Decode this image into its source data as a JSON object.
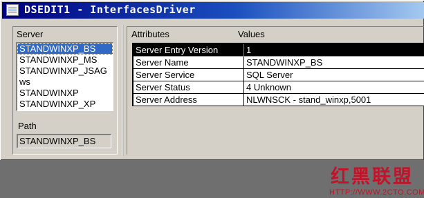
{
  "window": {
    "title": "DSEDIT1 - InterfacesDriver",
    "icon": "dsedit-app-icon"
  },
  "server_panel": {
    "label": "Server",
    "items": [
      "STANDWINXP_BS",
      "STANDWINXP_MS",
      "STANDWINXP_JSAG",
      "ws",
      "STANDWINXP",
      "STANDWINXP_XP"
    ],
    "selected_index": 0
  },
  "path_panel": {
    "label": "Path",
    "value": "STANDWINXP_BS"
  },
  "attributes_grid": {
    "col_attributes": "Attributes",
    "col_values": "Values",
    "rows": [
      {
        "attribute": "Server Entry Version",
        "value": "1"
      },
      {
        "attribute": "Server Name",
        "value": "STANDWINXP_BS"
      },
      {
        "attribute": "Server Service",
        "value": "SQL Server"
      },
      {
        "attribute": "Server Status",
        "value": "4   Unknown"
      },
      {
        "attribute": "Server Address",
        "value": "NLWNSCK - stand_winxp,5001"
      }
    ],
    "selected_index": 0
  },
  "watermark": {
    "logo_text": "红黑联盟",
    "url_text": "HTTP://WWW.2CTO.COM"
  },
  "colors": {
    "face": "#d4d0c8",
    "desktop": "#6f6f6f",
    "selection": "#316ac5",
    "title_start": "#000080",
    "watermark": "#c0142a"
  }
}
